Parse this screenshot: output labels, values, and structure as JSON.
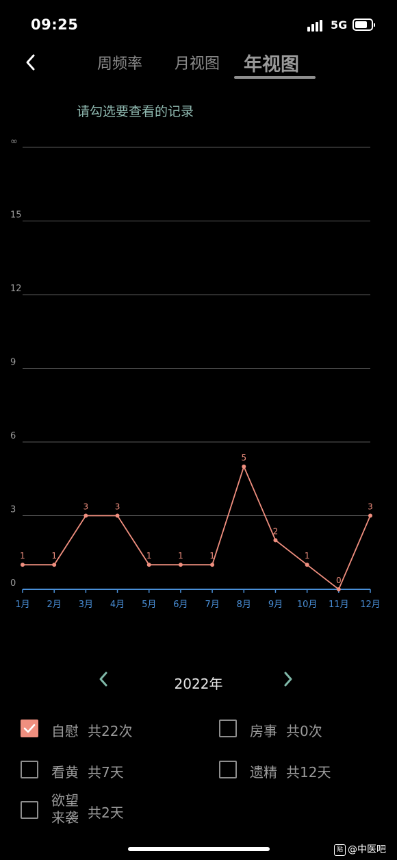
{
  "status_bar": {
    "time": "09:25",
    "network": "5G"
  },
  "tabs": [
    {
      "label": "周频率",
      "active": false
    },
    {
      "label": "月视图",
      "active": false
    },
    {
      "label": "年视图",
      "active": true
    }
  ],
  "hint": "请勾选要查看的记录",
  "chart_data": {
    "type": "line",
    "categories": [
      "1月",
      "2月",
      "3月",
      "4月",
      "5月",
      "6月",
      "7月",
      "8月",
      "9月",
      "10月",
      "11月",
      "12月"
    ],
    "y_ticks": [
      "0",
      "3",
      "6",
      "9",
      "12",
      "15",
      "∞"
    ],
    "series": [
      {
        "values": [
          1,
          1,
          3,
          3,
          1,
          1,
          1,
          5,
          2,
          1,
          0,
          3
        ],
        "color": "#f08f7f"
      }
    ],
    "data_labels": [
      "1",
      "1",
      "3",
      "3",
      "1",
      "1",
      "1",
      "5",
      "2",
      "1",
      "0",
      "3"
    ],
    "ylim": [
      0,
      18
    ],
    "grid": true,
    "axis_color": "#4a90d9",
    "grid_color": "#5a5a5a"
  },
  "year_nav": {
    "year": "2022年"
  },
  "records": [
    {
      "label": "自慰",
      "count": "共22次",
      "checked": true
    },
    {
      "label": "房事",
      "count": "共0次",
      "checked": false
    },
    {
      "label": "看黄",
      "count": "共7天",
      "checked": false
    },
    {
      "label": "遗精",
      "count": "共12天",
      "checked": false
    },
    {
      "label_lines": [
        "欲望",
        "来袭"
      ],
      "count": "共2天",
      "checked": false
    }
  ],
  "watermark": {
    "icon_text": "贴",
    "text": "@中医吧"
  }
}
